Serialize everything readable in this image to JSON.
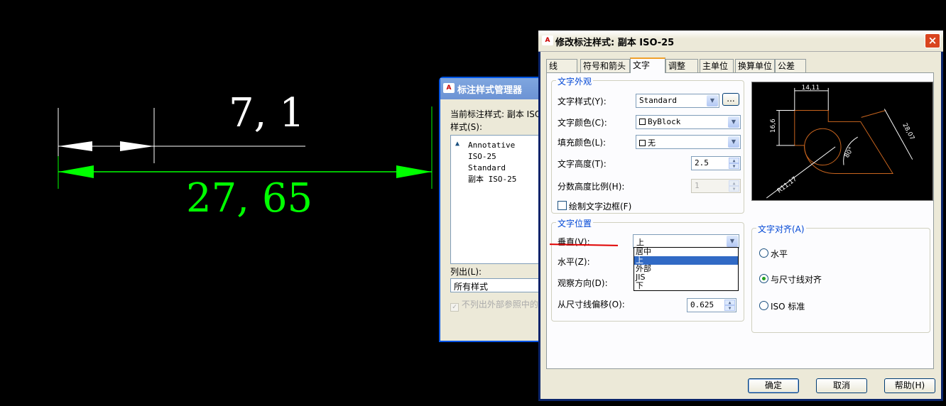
{
  "cad": {
    "top_dimension": "7, 1",
    "bottom_dimension": "27, 65"
  },
  "manager": {
    "title": "标注样式管理器",
    "current_style_label": "当前标注样式: 副本 ISO",
    "styles_label": "样式(S):",
    "styles": [
      "Annotative",
      "ISO-25",
      "Standard",
      "副本 ISO-25"
    ],
    "list_label": "列出(L):",
    "list_value": "所有样式",
    "exclude_xref_label": "不列出外部参照中的"
  },
  "dialog": {
    "title": "修改标注样式: 副本 ISO-25",
    "tabs": [
      "线",
      "符号和箭头",
      "文字",
      "调整",
      "主单位",
      "换算单位",
      "公差"
    ],
    "appearance": {
      "title": "文字外观",
      "text_style_label": "文字样式(Y):",
      "text_style_value": "Standard",
      "text_color_label": "文字颜色(C):",
      "text_color_value": "ByBlock",
      "fill_color_label": "填充颜色(L):",
      "fill_color_value": "无",
      "text_height_label": "文字高度(T):",
      "text_height_value": "2.5",
      "fraction_scale_label": "分数高度比例(H):",
      "fraction_scale_value": "1",
      "draw_frame_label": "绘制文字边框(F)"
    },
    "placement": {
      "title": "文字位置",
      "vertical_label": "垂直(V):",
      "vertical_value": "上",
      "vertical_options": [
        "居中",
        "上",
        "外部",
        "JIS",
        "下"
      ],
      "horizontal_label": "水平(Z):",
      "view_direction_label": "观察方向(D):",
      "offset_label": "从尺寸线偏移(O):",
      "offset_value": "0.625"
    },
    "alignment": {
      "title": "文字对齐(A)",
      "options": [
        "水平",
        "与尺寸线对齐",
        "ISO 标准"
      ],
      "selected": 1
    },
    "preview": {
      "dims": [
        "14,11",
        "16,6",
        "28,07",
        "80°",
        "R11,17"
      ]
    },
    "buttons": {
      "ok": "确定",
      "cancel": "取消",
      "help": "帮助(H)"
    },
    "accent_colors": {
      "cad_green": "#00ff00",
      "preview_orange": "#c8641e",
      "underline_red": "#e00000"
    }
  }
}
